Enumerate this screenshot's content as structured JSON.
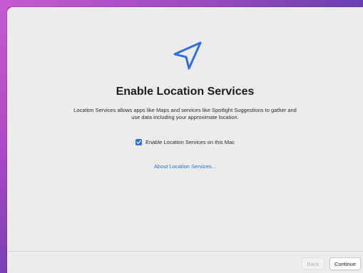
{
  "setup": {
    "title": "Enable Location Services",
    "description": "Location Services allows apps like Maps and services like Spotlight Suggestions to gather and use data including your approximate location.",
    "checkbox": {
      "label": "Enable Location Services on this Mac",
      "checked": true
    },
    "link_label": "About Location Services...",
    "hero_icon": "location-arrow-icon"
  },
  "footer": {
    "back_label": "Back",
    "back_enabled": false,
    "continue_label": "Continue"
  },
  "colors": {
    "accent": "#2f6fe0",
    "link": "#2a6fdb",
    "icon_stroke": "#2f6fe0",
    "window_bg": "#ececec"
  }
}
